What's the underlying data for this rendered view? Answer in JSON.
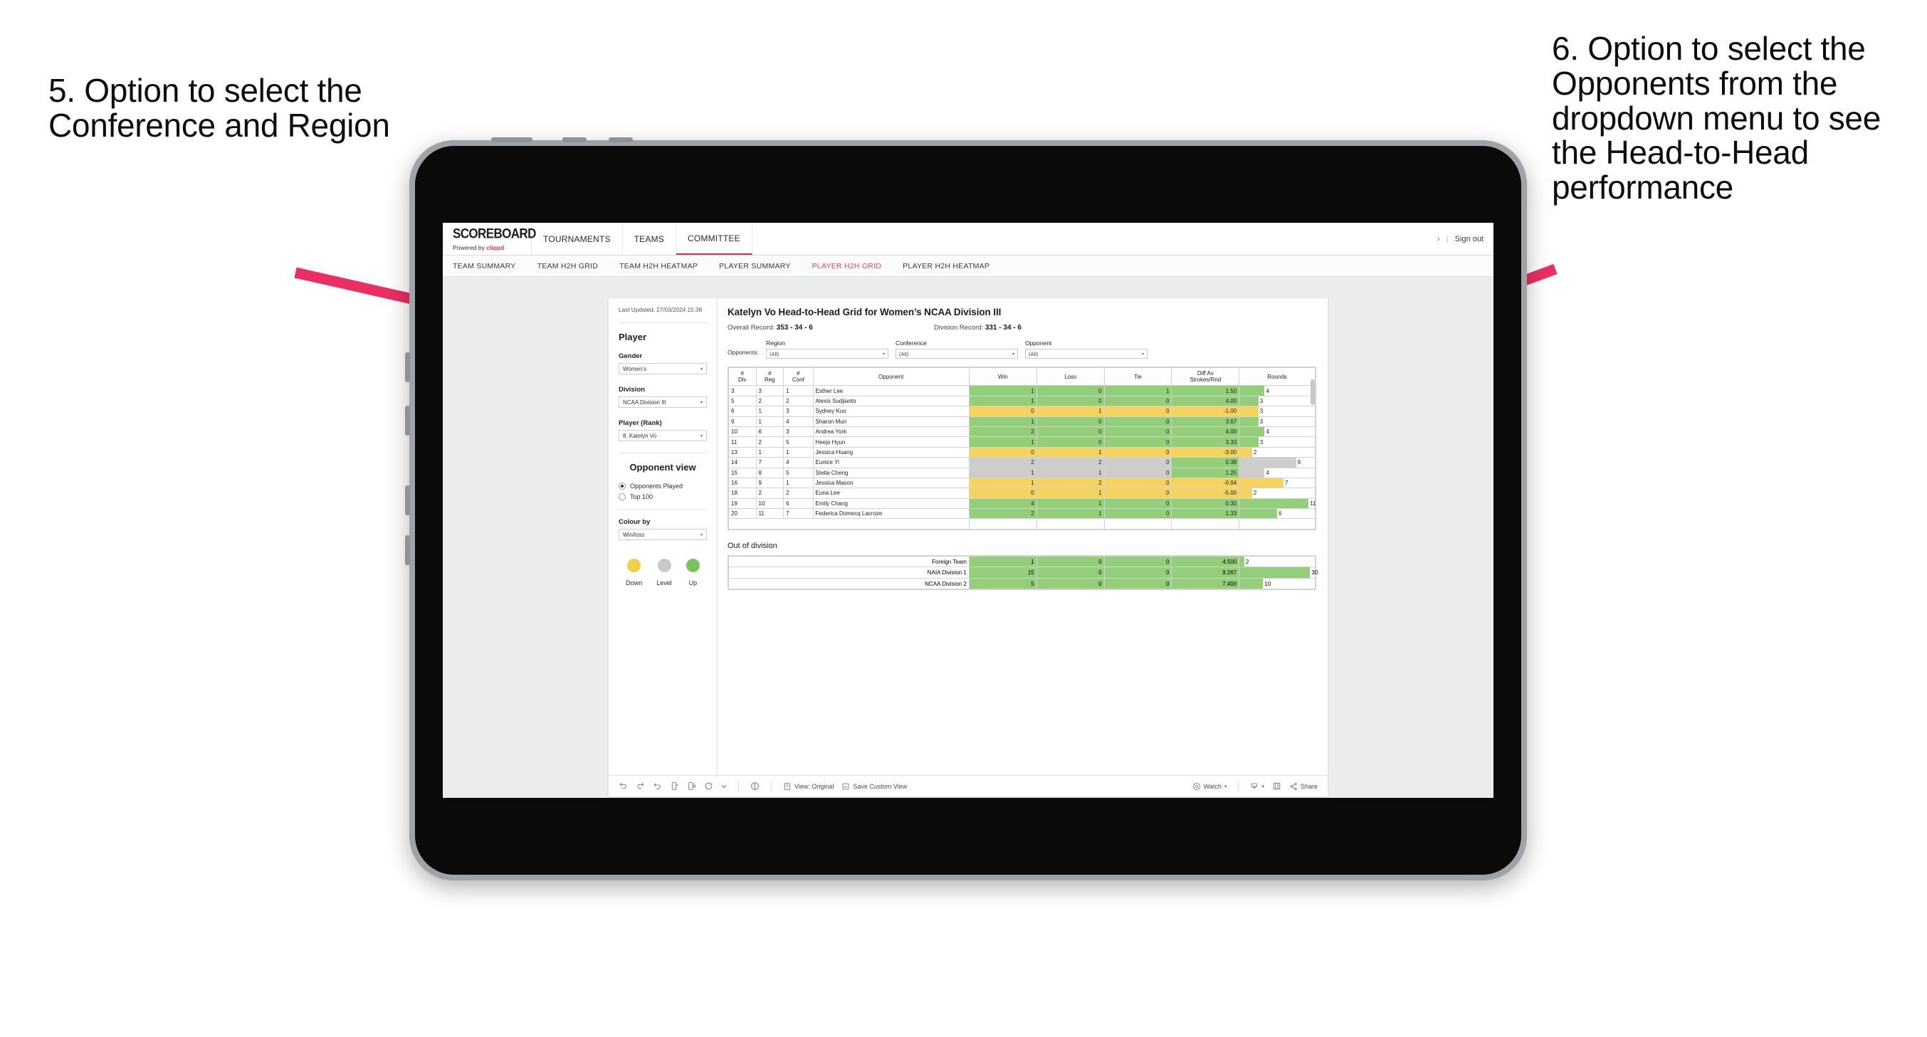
{
  "annotations": {
    "left": "5. Option to select the Conference and Region",
    "right": "6. Option to select the Opponents from the dropdown menu to see the Head-to-Head performance",
    "arrow_color": "#ec2f62"
  },
  "browser": {
    "topnav": {
      "brand_name": "SCOREBOARD",
      "brand_powered_prefix": "Powered by ",
      "brand_powered_name": "clippd",
      "items": [
        {
          "label": "TOURNAMENTS",
          "active": false
        },
        {
          "label": "TEAMS",
          "active": false
        },
        {
          "label": "COMMITTEE",
          "active": true
        }
      ],
      "chevron": "›",
      "separator": "|",
      "signout": "Sign out"
    },
    "subnav": {
      "tabs": [
        {
          "label": "TEAM SUMMARY",
          "active": false
        },
        {
          "label": "TEAM H2H GRID",
          "active": false
        },
        {
          "label": "TEAM H2H HEATMAP",
          "active": false
        },
        {
          "label": "PLAYER SUMMARY",
          "active": false
        },
        {
          "label": "PLAYER H2H GRID",
          "active": true
        },
        {
          "label": "PLAYER H2H HEATMAP",
          "active": false
        }
      ],
      "active_color": "#e8455f"
    }
  },
  "sidebar": {
    "last_updated": "Last Updated: 27/03/2024 15:38",
    "player_heading": "Player",
    "fields": [
      {
        "label": "Gender",
        "value": "Women’s"
      },
      {
        "label": "Division",
        "value": "NCAA Division III"
      },
      {
        "label": "Player (Rank)",
        "value": "8. Katelyn Vo"
      }
    ],
    "opponent_view": {
      "heading": "Opponent view",
      "options": [
        {
          "label": "Opponents Played",
          "selected": true
        },
        {
          "label": "Top 100",
          "selected": false
        }
      ]
    },
    "colour_by": {
      "label": "Colour by",
      "value": "Win/loss"
    },
    "legend": [
      {
        "label": "Down",
        "color": "#f1d049"
      },
      {
        "label": "Level",
        "color": "#c7c9cc"
      },
      {
        "label": "Up",
        "color": "#7cc25c"
      }
    ],
    "caret": "▾"
  },
  "main": {
    "title": "Katelyn Vo Head-to-Head Grid for Women’s NCAA Division III",
    "overall_record_label": "Overall Record: ",
    "overall_record_value": "353 - 34 - 6",
    "division_record_label": "Division Record: ",
    "division_record_value": "331 - 34 - 6",
    "opponents_label": "Opponents:",
    "filters": [
      {
        "label": "Region",
        "value": "(All)"
      },
      {
        "label": "Conference",
        "value": "(All)"
      },
      {
        "label": "Opponent",
        "value": "(All)"
      }
    ],
    "caret": "▾"
  },
  "chart_data": {
    "type": "table",
    "title": "Katelyn Vo Head-to-Head Grid for Women’s NCAA Division III",
    "columns": [
      "# Div",
      "# Reg",
      "# Conf",
      "Opponent",
      "Win",
      "Loss",
      "Tie",
      "Diff Av Strokes/Rnd",
      "Rounds"
    ],
    "column_header_lines": [
      [
        "#",
        "Div"
      ],
      [
        "#",
        "Reg"
      ],
      [
        "#",
        "Conf"
      ],
      [
        "Opponent",
        ""
      ],
      [
        "Win",
        ""
      ],
      [
        "Loss",
        ""
      ],
      [
        "Tie",
        ""
      ],
      [
        "Diff Av",
        "Strokes/Rnd"
      ],
      [
        "Rounds",
        ""
      ]
    ],
    "rounds_max": 12,
    "colors": {
      "up": "#93cf79",
      "down": "#f4d45f",
      "level": "#cdcdcd"
    },
    "rows": [
      {
        "div": "3",
        "reg": "3",
        "conf": "1",
        "opponent": "Esther Lee",
        "win": "1",
        "loss": "0",
        "tie": "1",
        "diff": "1.50",
        "rounds": "4",
        "state": "up"
      },
      {
        "div": "5",
        "reg": "2",
        "conf": "2",
        "opponent": "Alexis Sudjianto",
        "win": "1",
        "loss": "0",
        "tie": "0",
        "diff": "4.00",
        "rounds": "3",
        "state": "up"
      },
      {
        "div": "6",
        "reg": "1",
        "conf": "3",
        "opponent": "Sydney Kuo",
        "win": "0",
        "loss": "1",
        "tie": "0",
        "diff": "-1.00",
        "rounds": "3",
        "state": "down"
      },
      {
        "div": "9",
        "reg": "1",
        "conf": "4",
        "opponent": "Sharon Mun",
        "win": "1",
        "loss": "0",
        "tie": "0",
        "diff": "3.67",
        "rounds": "3",
        "state": "up"
      },
      {
        "div": "10",
        "reg": "6",
        "conf": "3",
        "opponent": "Andrea York",
        "win": "2",
        "loss": "0",
        "tie": "0",
        "diff": "4.00",
        "rounds": "4",
        "state": "up"
      },
      {
        "div": "11",
        "reg": "2",
        "conf": "5",
        "opponent": "Heejo Hyun",
        "win": "1",
        "loss": "0",
        "tie": "0",
        "diff": "3.33",
        "rounds": "3",
        "state": "up"
      },
      {
        "div": "13",
        "reg": "1",
        "conf": "1",
        "opponent": "Jessica Huang",
        "win": "0",
        "loss": "1",
        "tie": "0",
        "diff": "-3.00",
        "rounds": "2",
        "state": "down"
      },
      {
        "div": "14",
        "reg": "7",
        "conf": "4",
        "opponent": "Eunice Yi",
        "win": "2",
        "loss": "2",
        "tie": "0",
        "diff": "0.38",
        "rounds": "9",
        "state": "level",
        "diff_state": "up"
      },
      {
        "div": "15",
        "reg": "8",
        "conf": "5",
        "opponent": "Stella Cheng",
        "win": "1",
        "loss": "1",
        "tie": "0",
        "diff": "1.25",
        "rounds": "4",
        "state": "level",
        "diff_state": "up"
      },
      {
        "div": "16",
        "reg": "9",
        "conf": "1",
        "opponent": "Jessica Mason",
        "win": "1",
        "loss": "2",
        "tie": "0",
        "diff": "-0.94",
        "rounds": "7",
        "state": "down"
      },
      {
        "div": "18",
        "reg": "2",
        "conf": "2",
        "opponent": "Euna Lee",
        "win": "0",
        "loss": "1",
        "tie": "0",
        "diff": "-5.00",
        "rounds": "2",
        "state": "down"
      },
      {
        "div": "19",
        "reg": "10",
        "conf": "6",
        "opponent": "Emily Chang",
        "win": "4",
        "loss": "1",
        "tie": "0",
        "diff": "0.30",
        "rounds": "11",
        "state": "up"
      },
      {
        "div": "20",
        "reg": "11",
        "conf": "7",
        "opponent": "Federica Domecq Lacroze",
        "win": "2",
        "loss": "1",
        "tie": "0",
        "diff": "1.33",
        "rounds": "6",
        "state": "up"
      }
    ],
    "out_of_division": {
      "title": "Out of division",
      "rounds_max": 32,
      "rows": [
        {
          "name": "Foreign Team",
          "win": "1",
          "loss": "0",
          "tie": "0",
          "diff": "4.500",
          "rounds": "2",
          "state": "up"
        },
        {
          "name": "NAIA Division 1",
          "win": "15",
          "loss": "0",
          "tie": "0",
          "diff": "9.267",
          "rounds": "30",
          "state": "up"
        },
        {
          "name": "NCAA Division 2",
          "win": "5",
          "loss": "0",
          "tie": "0",
          "diff": "7.400",
          "rounds": "10",
          "state": "up"
        }
      ]
    }
  },
  "toolbar": {
    "view_label": "View: Original",
    "save_label": "Save Custom View",
    "watch_label": "Watch",
    "share_label": "Share",
    "caret": "▾"
  }
}
